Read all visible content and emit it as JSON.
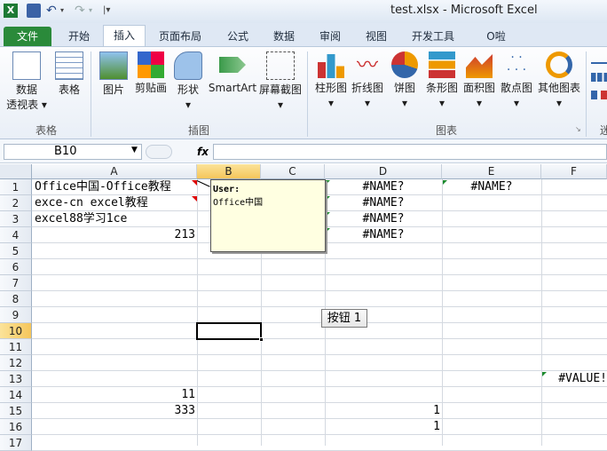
{
  "window": {
    "title": "test.xlsx  -  Microsoft Excel"
  },
  "tabs": {
    "file": "文件",
    "home": "开始",
    "insert": "插入",
    "page_layout": "页面布局",
    "formulas": "公式",
    "data": "数据",
    "review": "审阅",
    "view": "视图",
    "developer": "开发工具",
    "oo": "O啦"
  },
  "ribbon": {
    "pivot_line1": "数据",
    "pivot_line2": "透视表 ▾",
    "table": "表格",
    "picture": "图片",
    "clipart": "剪贴画",
    "shapes": "形状",
    "smartart": "SmartArt",
    "screenshot": "屏幕截图",
    "column": "柱形图",
    "line": "折线图",
    "pie": "饼图",
    "bar": "条形图",
    "area": "面积图",
    "scatter": "散点图",
    "other": "其他图表",
    "group_tables": "表格",
    "group_illustrations": "插图",
    "group_charts": "图表",
    "group_sparkline": "迷"
  },
  "formula_bar": {
    "name_box": "B10",
    "fx": "fx"
  },
  "columns": [
    "A",
    "B",
    "C",
    "D",
    "E",
    "F"
  ],
  "rows": [
    "1",
    "2",
    "3",
    "4",
    "5",
    "6",
    "7",
    "8",
    "9",
    "10",
    "11",
    "12",
    "13",
    "14",
    "15",
    "16",
    "17"
  ],
  "cells": {
    "A1": "Office中国-Office教程",
    "A2": "exce-cn excel教程",
    "A3": "excel88学习1ce",
    "A4": "213",
    "D1": "#NAME?",
    "D2": "#NAME?",
    "D3": "#NAME?",
    "D4": "#NAME?",
    "E1": "#NAME?",
    "F13": "#VALUE!",
    "A14": "11",
    "A15": "333",
    "D15": "1",
    "D16": "1"
  },
  "comment": {
    "author": "User:",
    "text": "Office中国"
  },
  "form_button": "按钮 1"
}
